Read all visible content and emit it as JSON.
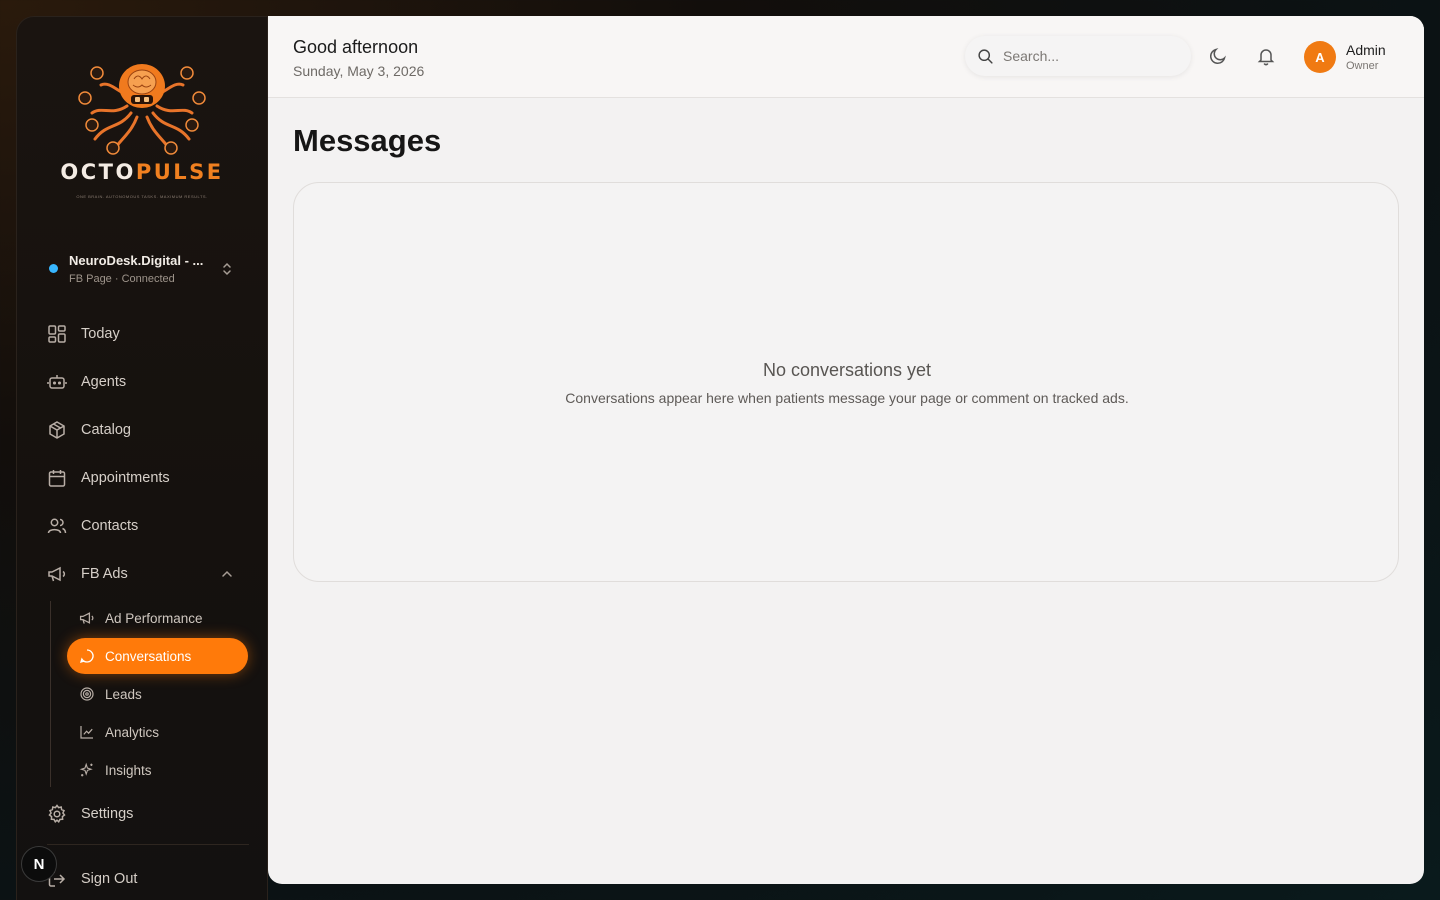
{
  "brand": {
    "name_part1": "OCTO",
    "name_part2": "PULSE",
    "tagline": "ONE BRAIN. AUTONOMOUS TASKS. MAXIMUM RESULTS."
  },
  "account": {
    "name": "NeuroDesk.Digital - ...",
    "status": "FB Page · Connected"
  },
  "nav": {
    "today": "Today",
    "agents": "Agents",
    "catalog": "Catalog",
    "appointments": "Appointments",
    "contacts": "Contacts",
    "fb_ads": "FB Ads",
    "settings": "Settings",
    "sign_out": "Sign Out"
  },
  "fb_ads_sub": {
    "ad_performance": "Ad Performance",
    "conversations": "Conversations",
    "leads": "Leads",
    "analytics": "Analytics",
    "insights": "Insights"
  },
  "n_badge": "N",
  "header": {
    "greeting": "Good afternoon",
    "date": "Sunday, May 3, 2026",
    "search_placeholder": "Search...",
    "user_initial": "A",
    "user_name": "Admin",
    "user_role": "Owner"
  },
  "page": {
    "title": "Messages",
    "empty_title": "No conversations yet",
    "empty_subtitle": "Conversations appear here when patients message your page or comment on tracked ads."
  },
  "colors": {
    "accent": "#ff7a0a",
    "status_dot": "#38b6ff"
  }
}
